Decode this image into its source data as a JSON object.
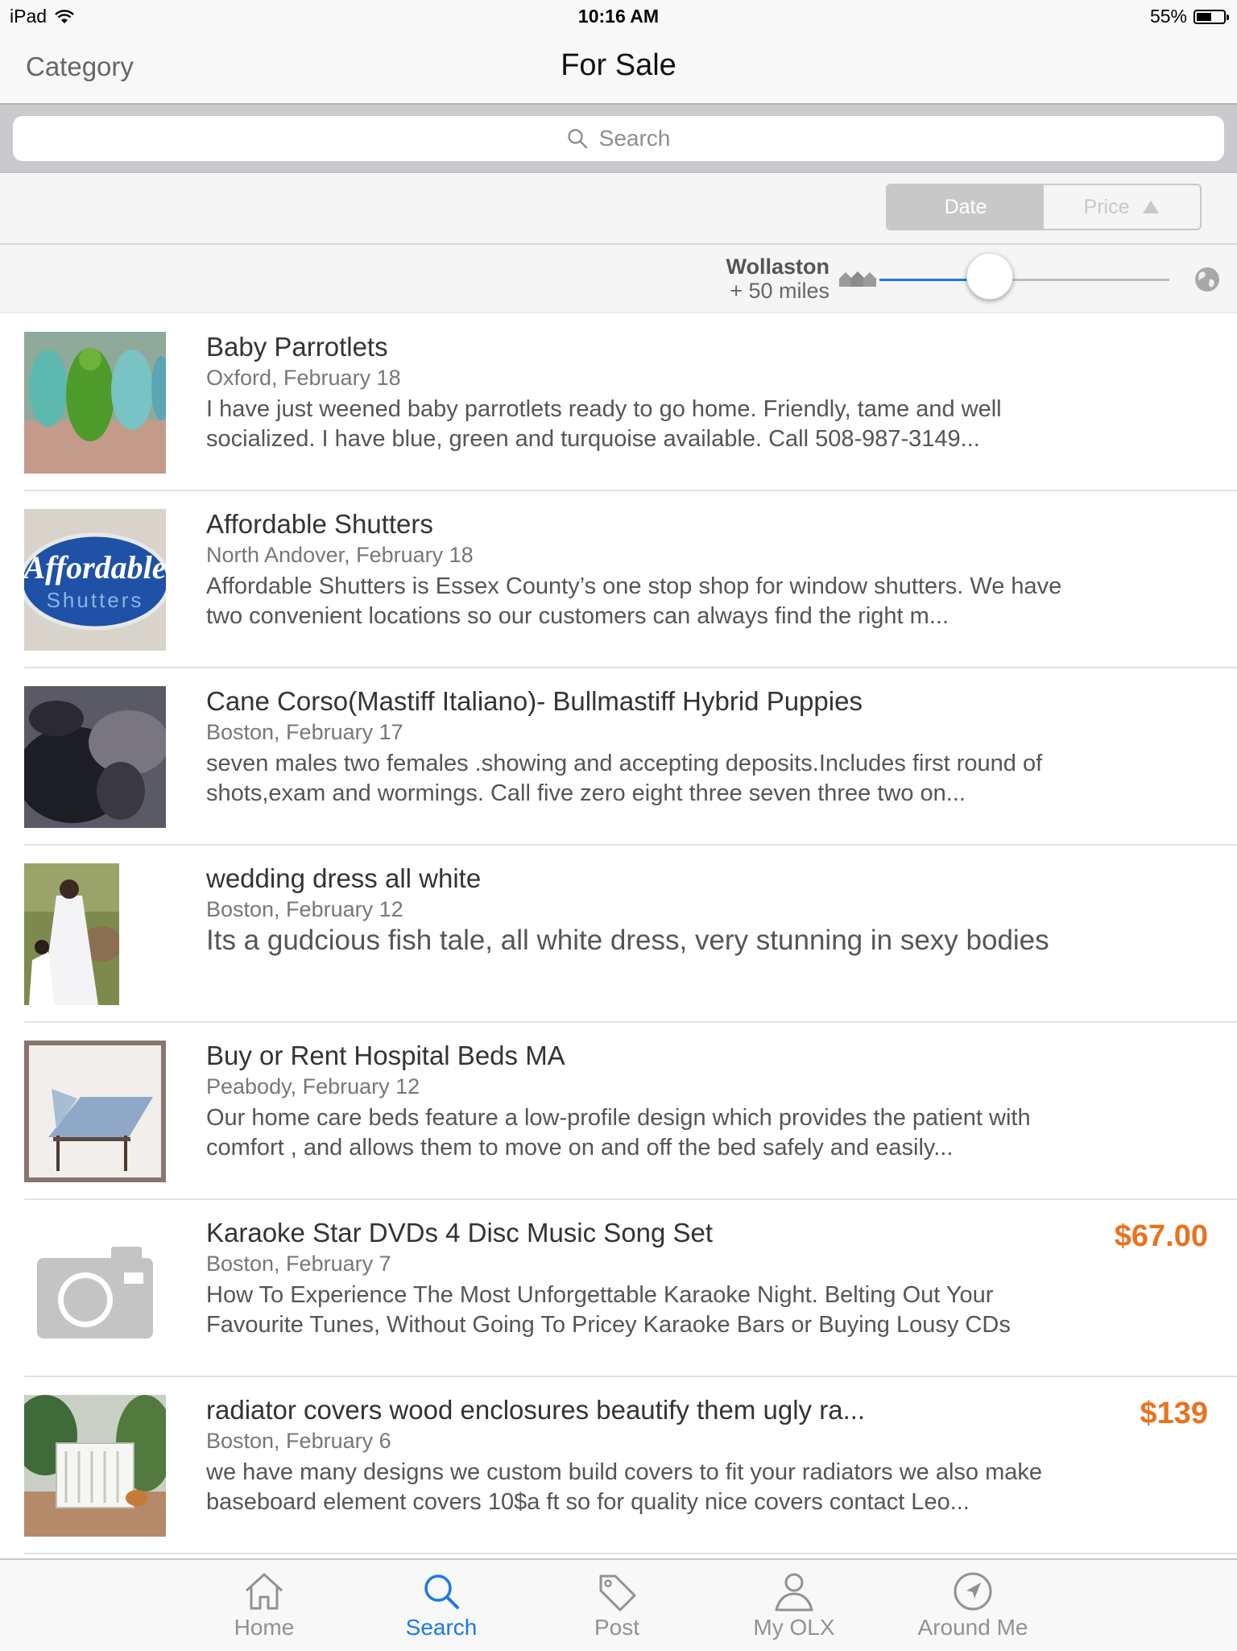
{
  "status_bar": {
    "device": "iPad",
    "time": "10:16 AM",
    "battery": "55%",
    "battery_level": 0.55
  },
  "nav": {
    "back_label": "Category",
    "title": "For Sale"
  },
  "search": {
    "placeholder": "Search"
  },
  "sort": {
    "options": [
      "Date",
      "Price"
    ],
    "selected": "Date"
  },
  "location": {
    "name": "Wollaston",
    "radius": "+ 50 miles",
    "radius_slider_fraction": 0.38
  },
  "listings": [
    {
      "title": "Baby Parrotlets",
      "meta": "Oxford, February 18",
      "description": "I have just weened baby parrotlets ready to go home. Friendly, tame and well socialized. I have blue, green and turquoise available. Call 508-987-3149...",
      "price": ""
    },
    {
      "title": "Affordable Shutters",
      "meta": "North Andover, February 18",
      "description": "Affordable Shutters is Essex County’s one stop shop for window shutters. We have two convenient locations so our customers can always find the right m...",
      "price": "",
      "logo_text": [
        "Affordable",
        "Shutters"
      ]
    },
    {
      "title": "Cane Corso(Mastiff Italiano)- Bullmastiff Hybrid Puppies",
      "meta": "Boston, February 17",
      "description": "seven males two females .showing and accepting deposits.Includes first round of shots,exam and wormings. Call five zero eight three seven three two on...",
      "price": ""
    },
    {
      "title": "wedding dress all white",
      "meta": "Boston, February 12",
      "description": "Its a gudcious fish tale, all white dress, very stunning in sexy bodies",
      "price": ""
    },
    {
      "title": "Buy or Rent Hospital Beds MA",
      "meta": "Peabody, February 12",
      "description": "Our home care beds feature a low-profile design which provides the patient with comfort , and allows them to move on and off the bed safely and easily...",
      "price": ""
    },
    {
      "title": "Karaoke Star DVDs 4 Disc Music Song Set",
      "meta": "Boston, February 7",
      "description": "How To Experience The Most Unforgettable Karaoke Night. Belting Out Your Favourite Tunes, Without Going To Pricey Karaoke Bars or Buying Lousy CDs",
      "price": "$67.00"
    },
    {
      "title": "radiator covers wood enclosures beautify them ugly ra...",
      "meta": "Boston, February 6",
      "description": "we have many designs we custom build covers to fit your radiators we also make baseboard element covers 10$a ft so for quality nice covers contact Leo...",
      "price": "$139"
    }
  ],
  "tabs": [
    {
      "label": "Home",
      "icon": "home-icon"
    },
    {
      "label": "Search",
      "icon": "search-icon",
      "active": true
    },
    {
      "label": "Post",
      "icon": "tag-icon"
    },
    {
      "label": "My OLX",
      "icon": "person-icon"
    },
    {
      "label": "Around Me",
      "icon": "location-arrow-icon"
    }
  ],
  "colors": {
    "accent": "#1a7ae2",
    "price": "#e8731e"
  }
}
